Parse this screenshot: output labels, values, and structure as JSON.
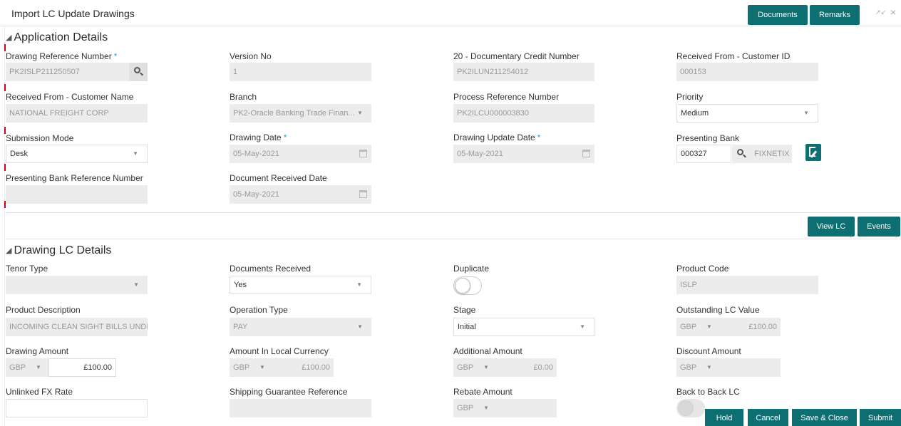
{
  "window": {
    "title": "Import LC Update Drawings",
    "documents_label": "Documents",
    "remarks_label": "Remarks",
    "minimize_glyph": "↗↙",
    "close_glyph": "×"
  },
  "application_details": {
    "title": "Application Details",
    "drawing_reference_number": {
      "label": "Drawing Reference Number",
      "value": "PK2ISLP211250507"
    },
    "version_no": {
      "label": "Version No",
      "value": "1"
    },
    "documentary_credit_number": {
      "label": "20 - Documentary Credit Number",
      "value": "PK2ILUN211254012"
    },
    "customer_id": {
      "label": "Received From - Customer ID",
      "value": "000153"
    },
    "customer_name": {
      "label": "Received From - Customer Name",
      "value": "NATIONAL FREIGHT CORP"
    },
    "branch": {
      "label": "Branch",
      "value": "PK2-Oracle Banking Trade Finan..."
    },
    "process_reference_number": {
      "label": "Process Reference Number",
      "value": "PK2ILCU000003830"
    },
    "priority": {
      "label": "Priority",
      "value": "Medium"
    },
    "submission_mode": {
      "label": "Submission Mode",
      "value": "Desk"
    },
    "drawing_date": {
      "label": "Drawing Date",
      "value": "05-May-2021"
    },
    "drawing_update_date": {
      "label": "Drawing Update Date",
      "value": "05-May-2021"
    },
    "presenting_bank": {
      "label": "Presenting Bank",
      "value": "000327",
      "name": "FIXNETIX"
    },
    "presenting_bank_reference_number": {
      "label": "Presenting Bank Reference Number",
      "value": ""
    },
    "document_received_date": {
      "label": "Document Received Date",
      "value": "05-May-2021"
    }
  },
  "actions": {
    "view_lc": "View LC",
    "events": "Events"
  },
  "drawing_lc_details": {
    "title": "Drawing LC Details",
    "tenor_type": {
      "label": "Tenor Type",
      "value": ""
    },
    "documents_received": {
      "label": "Documents Received",
      "value": "Yes"
    },
    "duplicate": {
      "label": "Duplicate",
      "on": false
    },
    "product_code": {
      "label": "Product Code",
      "value": "ISLP"
    },
    "product_description": {
      "label": "Product Description",
      "value": "INCOMING CLEAN SIGHT BILLS UNDER"
    },
    "operation_type": {
      "label": "Operation Type",
      "value": "PAY"
    },
    "stage": {
      "label": "Stage",
      "value": "Initial"
    },
    "outstanding_lc_value": {
      "label": "Outstanding LC Value",
      "currency": "GBP",
      "amount": "£100.00"
    },
    "drawing_amount": {
      "label": "Drawing Amount",
      "currency": "GBP",
      "amount": "£100.00"
    },
    "amount_local_currency": {
      "label": "Amount In Local Currency",
      "currency": "GBP",
      "amount": "£100.00"
    },
    "additional_amount": {
      "label": "Additional Amount",
      "currency": "GBP",
      "amount": "£0.00"
    },
    "discount_amount": {
      "label": "Discount Amount",
      "currency": "GBP",
      "amount": ""
    },
    "unlinked_fx_rate": {
      "label": "Unlinked FX Rate",
      "value": ""
    },
    "shipping_guarantee_reference": {
      "label": "Shipping Guarantee Reference",
      "value": ""
    },
    "rebate_amount": {
      "label": "Rebate Amount",
      "currency": "GBP",
      "amount": ""
    },
    "back_to_back_lc": {
      "label": "Back to Back LC",
      "on": false
    }
  },
  "footer": {
    "hold": "Hold",
    "cancel": "Cancel",
    "save_close": "Save & Close",
    "submit": "Submit"
  },
  "icons": {
    "dropdown": "▼",
    "collapse": "◢"
  },
  "colors": {
    "primary": "#0d6f72",
    "required": "#2aa2c9",
    "readonly": "#ececec"
  }
}
